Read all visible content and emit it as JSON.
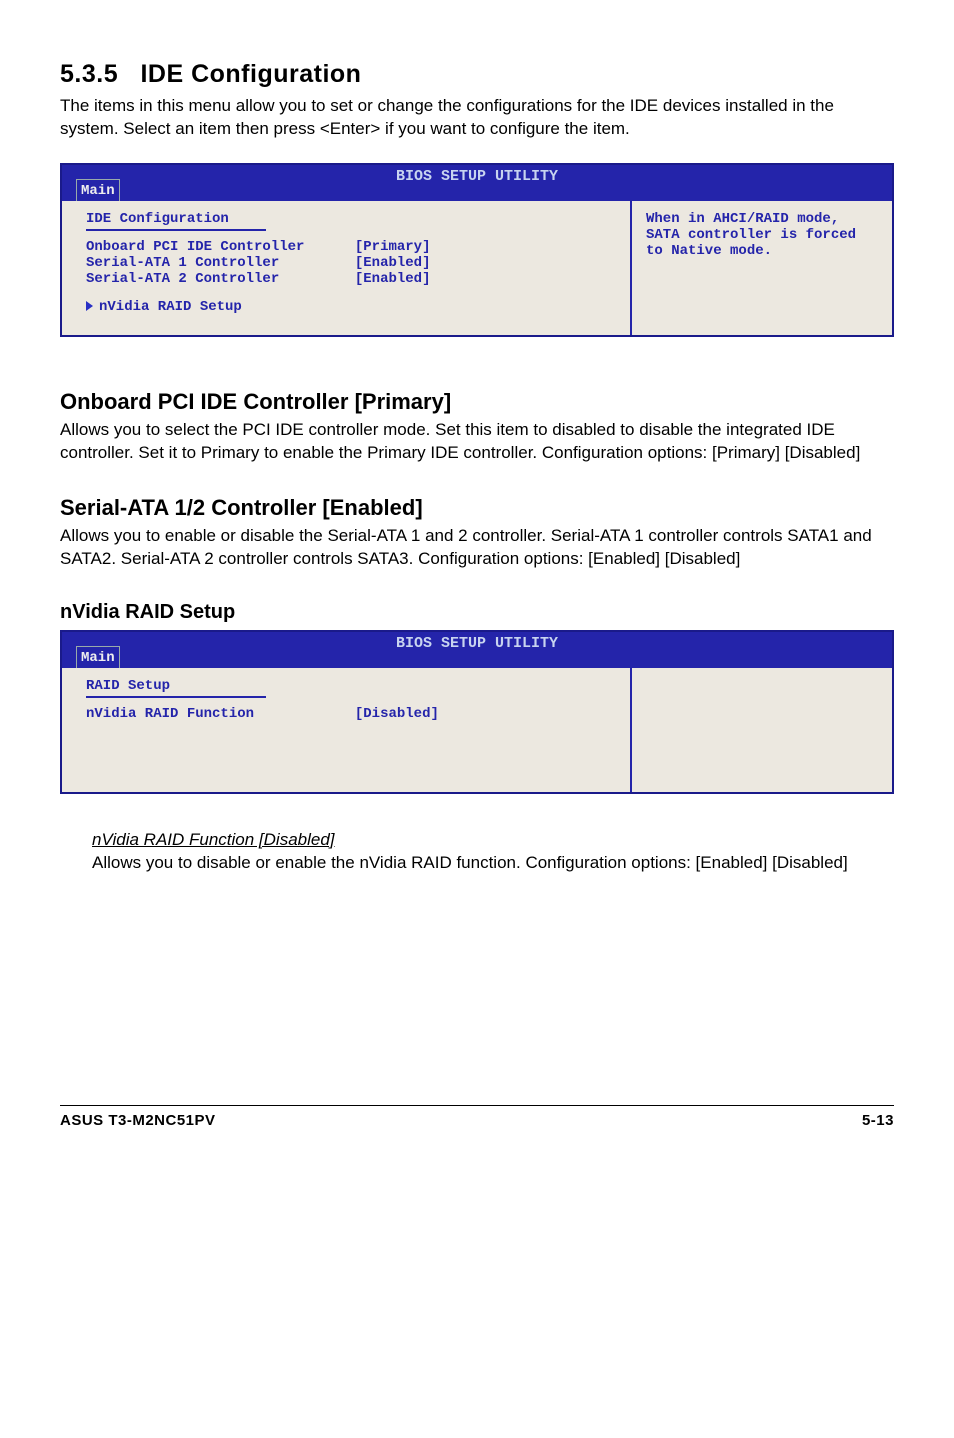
{
  "section_number": "5.3.5",
  "section_title": "IDE Configuration",
  "intro_text": "The items in this menu allow you to set or change the configurations for the IDE devices installed in the system. Select an item then press <Enter> if you want to configure the item.",
  "bios1": {
    "title": "BIOS SETUP UTILITY",
    "tab": "Main",
    "left_title": "IDE Configuration",
    "rows": [
      {
        "label": "Onboard PCI IDE Controller",
        "value": "[Primary]"
      },
      {
        "label": "Serial-ATA 1 Controller",
        "value": "[Enabled]"
      },
      {
        "label": "Serial-ATA 2 Controller",
        "value": "[Enabled]"
      }
    ],
    "submenu": "nVidia RAID Setup",
    "help": "When in AHCI/RAID mode, SATA controller is forced to Native mode."
  },
  "sub1_head": "Onboard PCI IDE Controller [Primary]",
  "sub1_body": "Allows you to select the PCI IDE controller mode. Set this item to disabled to disable the integrated IDE controller. Set it to Primary to enable the Primary IDE controller. Configuration options: [Primary] [Disabled]",
  "sub2_head": "Serial-ATA 1/2 Controller [Enabled]",
  "sub2_body": "Allows you to enable or disable the Serial-ATA 1 and 2 controller. Serial-ATA 1 controller controls SATA1 and SATA2. Serial-ATA 2 controller controls SATA3. Configuration options: [Enabled] [Disabled]",
  "sub3_head": "nVidia RAID Setup",
  "bios2": {
    "title": "BIOS SETUP UTILITY",
    "tab": "Main",
    "left_title": "RAID Setup",
    "rows": [
      {
        "label": "nVidia RAID Function",
        "value": "[Disabled]"
      }
    ]
  },
  "raid_func_head": "nVidia RAID Function [Disabled]",
  "raid_func_body": "Allows you to disable or enable the nVidia RAID function. Configuration options: [Enabled] [Disabled]",
  "footer_left": "ASUS T3-M2NC51PV",
  "footer_right": "5-13"
}
